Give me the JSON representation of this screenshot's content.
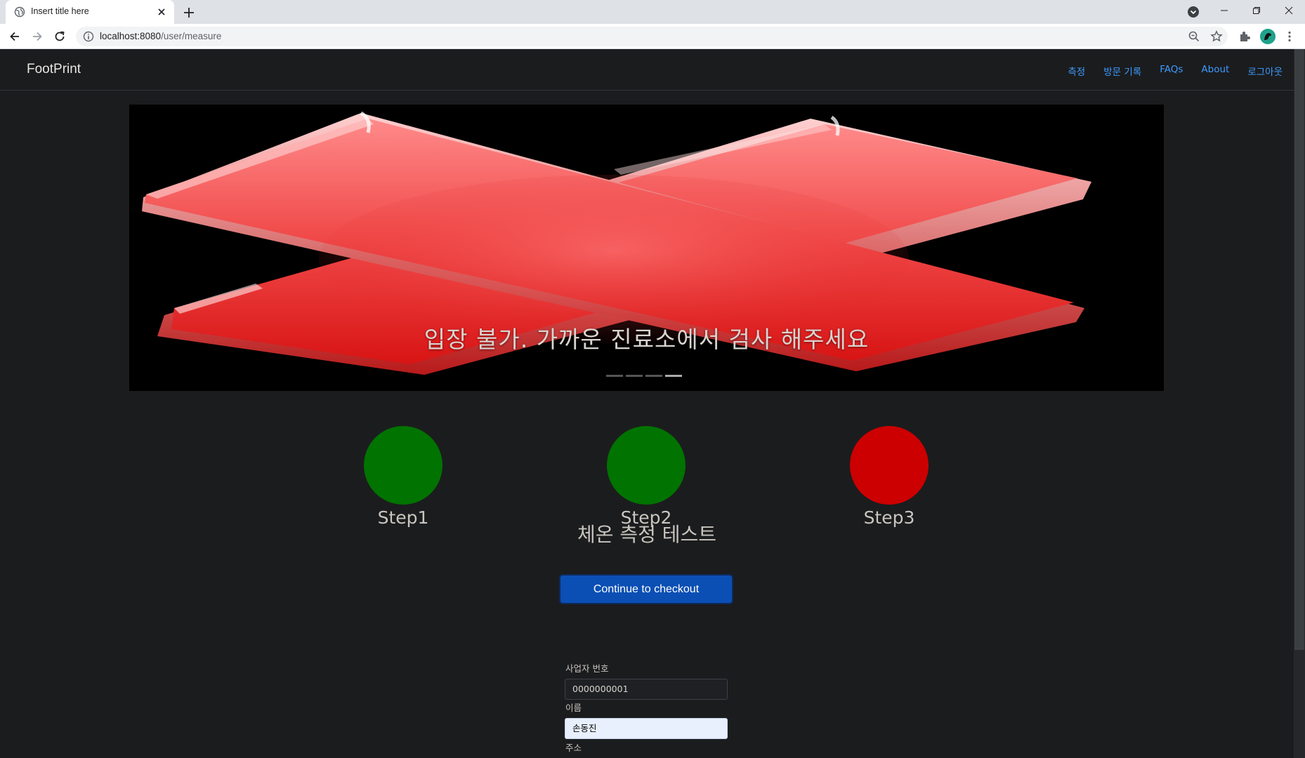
{
  "browser": {
    "tab_title": "Insert title here",
    "url_host": "localhost:8080",
    "url_path": "/user/measure"
  },
  "navbar": {
    "brand": "FootPrint",
    "links": [
      "측정",
      "방문 기록",
      "FAQs",
      "About",
      "로그아웃"
    ]
  },
  "hero": {
    "caption": "입장 불가. 가까운 진료소에서 검사 해주세요",
    "indicator_count": 4,
    "active_indicator": 4
  },
  "steps": [
    {
      "label": "Step1",
      "color": "#007300"
    },
    {
      "label": "Step2",
      "color": "#007300"
    },
    {
      "label": "Step3",
      "color": "#cc0000"
    }
  ],
  "measure": {
    "title": "체온 측정 테스트",
    "checkout_label": "Continue to checkout",
    "business_number_label": "사업자 번호",
    "business_number_value": "0000000001",
    "name_label": "이름",
    "name_value": "손동진",
    "address_label": "주소"
  },
  "colors": {
    "link": "#3d9bff",
    "button": "#0b4fb4",
    "step_ok": "#007300",
    "step_fail": "#cc0000"
  }
}
